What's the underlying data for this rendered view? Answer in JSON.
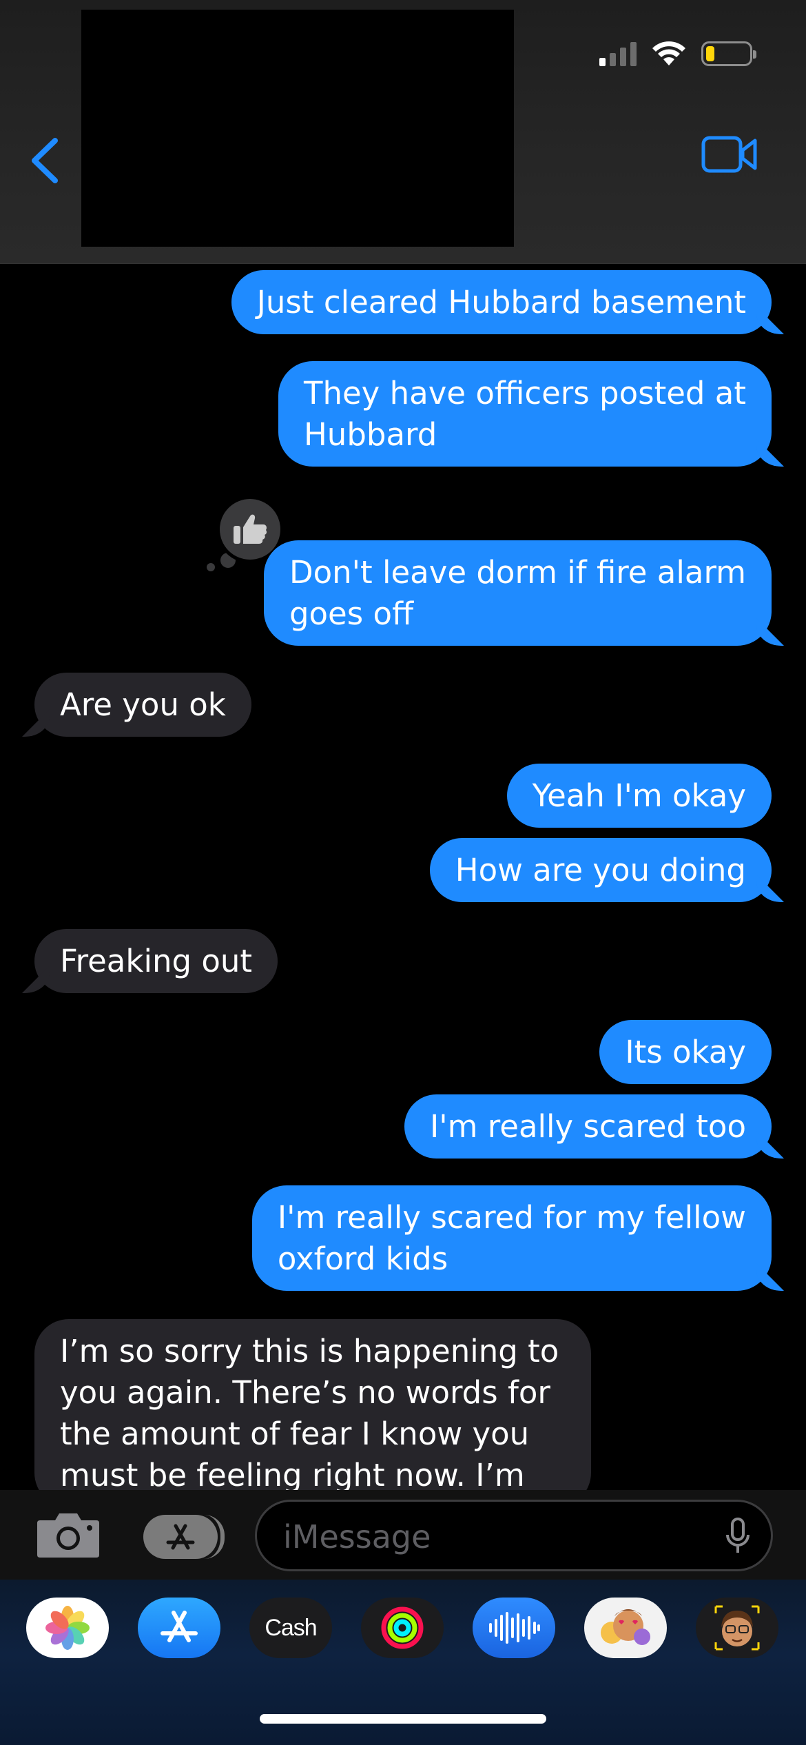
{
  "header": {
    "back_icon": "chevron-left-icon",
    "video_icon": "video-camera-icon",
    "status_icons": [
      "cellular-signal-icon",
      "wifi-icon",
      "battery-icon"
    ],
    "battery_level": 0.2,
    "battery_color": "#ffd60a",
    "contact_redacted": true
  },
  "colors": {
    "accent": "#1f8bff",
    "sent_bubble": "#1f8bff",
    "received_bubble": "#26252a",
    "background": "#000000"
  },
  "messages": [
    {
      "side": "out",
      "text": "Just cleared Hubbard basement"
    },
    {
      "side": "out",
      "text": "They have officers posted at\nHubbard"
    },
    {
      "side": "out",
      "text": "Don't leave dorm if fire alarm\ngoes off",
      "tapback": "thumbs-up-icon"
    },
    {
      "side": "in",
      "text": "Are you ok"
    },
    {
      "side": "out",
      "text": "Yeah I'm okay"
    },
    {
      "side": "out",
      "text": "How are you doing"
    },
    {
      "side": "in",
      "text": "Freaking out"
    },
    {
      "side": "out",
      "text": "Its okay"
    },
    {
      "side": "out",
      "text": "I'm really scared too"
    },
    {
      "side": "out",
      "text": "I'm really scared for my fellow\noxford kids"
    },
    {
      "side": "in",
      "text": "I’m so sorry this is happening to\nyou again. There’s no words for\nthe amount of fear I know you\nmust be feeling right now. I’m"
    }
  ],
  "composer": {
    "placeholder": "iMessage",
    "camera_icon": "camera-icon",
    "apps_icon": "app-store-icon",
    "mic_icon": "microphone-icon"
  },
  "app_drawer": {
    "apps": [
      {
        "name": "photos-app-icon"
      },
      {
        "name": "app-store-app-icon"
      },
      {
        "name": "apple-cash-app-icon",
        "label": "Cash"
      },
      {
        "name": "fitness-app-icon"
      },
      {
        "name": "audio-message-app-icon"
      },
      {
        "name": "memoji-stickers-app-icon"
      },
      {
        "name": "memoji-app-icon"
      }
    ]
  }
}
